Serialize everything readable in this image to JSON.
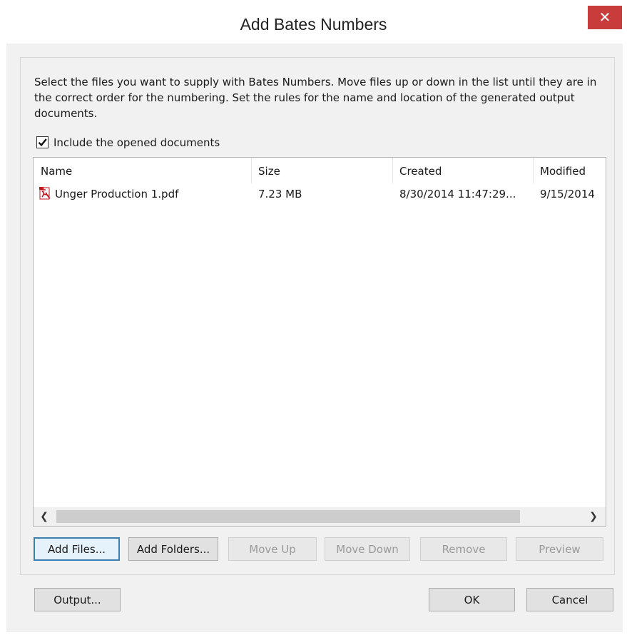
{
  "window": {
    "title": "Add Bates Numbers",
    "close_glyph": "✕"
  },
  "description": "Select the files you want to supply with Bates Numbers. Move files up or down in the list until they are in the correct order for the numbering. Set the rules for the name and location of the generated output documents.",
  "include_opened": {
    "label": "Include the opened documents",
    "checked": true
  },
  "file_list": {
    "columns": [
      "Name",
      "Size",
      "Created",
      "Modified"
    ],
    "rows": [
      {
        "name": "Unger Production 1.pdf",
        "size": "7.23 MB",
        "created": "8/30/2014 11:47:29...",
        "modified": "9/15/2014",
        "icon": "pdf-icon"
      }
    ],
    "scroll_left_glyph": "❮",
    "scroll_right_glyph": "❯"
  },
  "buttons": {
    "add_files": "Add Files...",
    "add_folders": "Add Folders...",
    "move_up": "Move Up",
    "move_down": "Move Down",
    "remove": "Remove",
    "preview": "Preview",
    "output": "Output...",
    "ok": "OK",
    "cancel": "Cancel"
  },
  "colors": {
    "close_button": "#c83c3c",
    "pdf_icon": "#c4161c",
    "default_button_border": "#3c7fb1"
  }
}
